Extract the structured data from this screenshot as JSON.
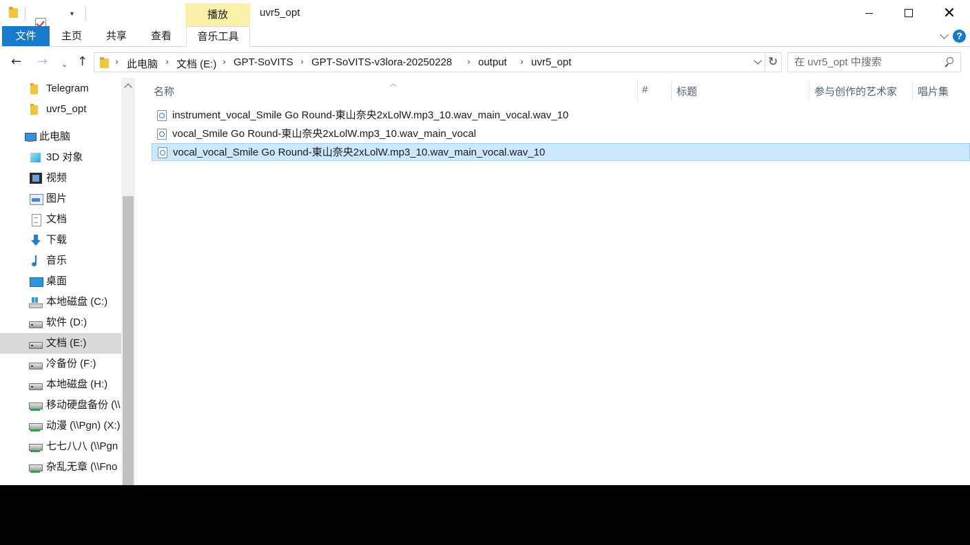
{
  "window": {
    "title": "uvr5_opt",
    "contextual_tab_group": "播放"
  },
  "ribbon": {
    "tabs": [
      {
        "label": "文件",
        "active": true
      },
      {
        "label": "主页"
      },
      {
        "label": "共享"
      },
      {
        "label": "查看"
      },
      {
        "label": "音乐工具"
      }
    ],
    "help": "?"
  },
  "navigation": {
    "back": "←",
    "forward": "→",
    "up": "↑",
    "breadcrumb": [
      "此电脑",
      "文档 (E:)",
      "GPT-SoVITS",
      "GPT-SoVITS-v3lora-20250228",
      "output",
      "uvr5_opt"
    ],
    "refresh": "↻",
    "search_placeholder": "在 uvr5_opt 中搜索"
  },
  "sidebar": {
    "items": [
      {
        "label": "Telegram",
        "icon": "folder-icon"
      },
      {
        "label": "uvr5_opt",
        "icon": "folder-icon"
      },
      {
        "label": "此电脑",
        "icon": "this-pc-icon"
      },
      {
        "label": "3D 对象",
        "icon": "3d-objects-icon"
      },
      {
        "label": "视频",
        "icon": "video-icon"
      },
      {
        "label": "图片",
        "icon": "pictures-icon"
      },
      {
        "label": "文档",
        "icon": "documents-icon"
      },
      {
        "label": "下载",
        "icon": "download-icon"
      },
      {
        "label": "音乐",
        "icon": "music-icon"
      },
      {
        "label": "桌面",
        "icon": "desktop-icon"
      },
      {
        "label": "本地磁盘 (C:)",
        "icon": "windows-drive-icon"
      },
      {
        "label": "软件 (D:)",
        "icon": "drive-icon"
      },
      {
        "label": "文档 (E:)",
        "icon": "drive-icon",
        "selected": true
      },
      {
        "label": "冷备份 (F:)",
        "icon": "drive-icon"
      },
      {
        "label": "本地磁盘 (H:)",
        "icon": "drive-icon"
      },
      {
        "label": "移动硬盘备份 (\\\\",
        "icon": "network-drive-icon"
      },
      {
        "label": "动漫 (\\\\Pgn) (X:)",
        "icon": "network-drive-icon"
      },
      {
        "label": "七七八八 (\\\\Pgn",
        "icon": "network-drive-icon"
      },
      {
        "label": "杂乱无章 (\\\\Fno",
        "icon": "network-drive-icon"
      }
    ]
  },
  "columns": [
    "名称",
    "#",
    "标题",
    "参与创作的艺术家",
    "唱片集"
  ],
  "files": [
    {
      "name": "instrument_vocal_Smile Go Round-東山奈央2xLolW.mp3_10.wav_main_vocal.wav_10"
    },
    {
      "name": "vocal_Smile Go Round-東山奈央2xLolW.mp3_10.wav_main_vocal"
    },
    {
      "name": "vocal_vocal_Smile Go Round-東山奈央2xLolW.mp3_10.wav_main_vocal.wav_10",
      "selected": true
    }
  ]
}
